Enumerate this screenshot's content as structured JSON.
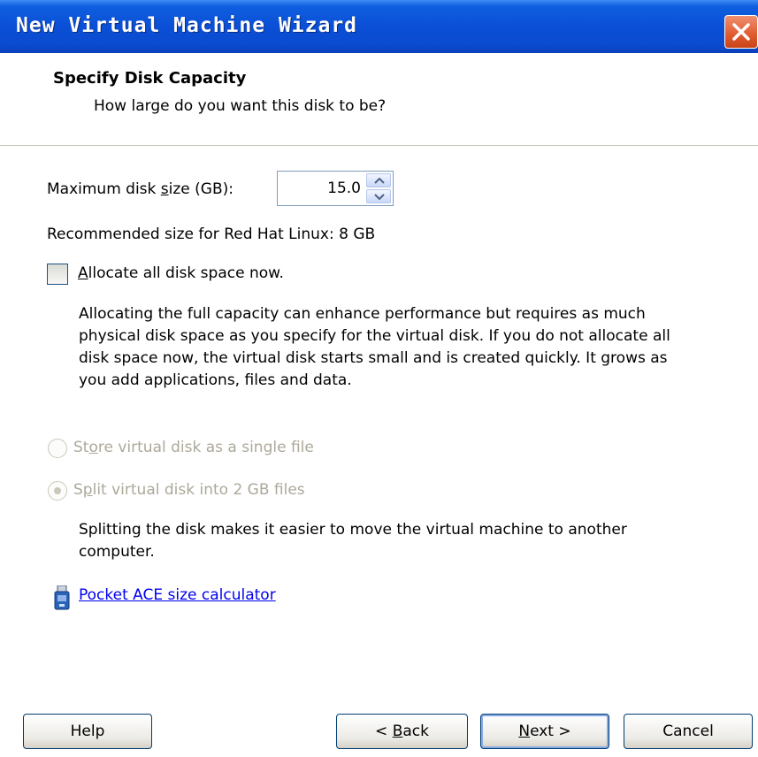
{
  "window": {
    "title": "New Virtual Machine Wizard"
  },
  "header": {
    "title": "Specify Disk Capacity",
    "subtitle": "How large do you want this disk to be?"
  },
  "disk_size": {
    "label_prefix": "Maximum disk ",
    "label_mnemonic": "s",
    "label_suffix": "ize (GB):",
    "value": "15.0"
  },
  "recommended": "Recommended size for Red Hat Linux: 8 GB",
  "allocate": {
    "mnemonic": "A",
    "label_rest": "llocate all disk space now.",
    "checked": false,
    "description_lines": [
      "Allocating the full capacity can enhance performance but requires as much",
      "physical disk space as you specify for the virtual disk. If you do not allocate all",
      "disk space now, the virtual disk starts small and is created quickly. It grows as",
      "you add applications, files and data."
    ]
  },
  "store_single": {
    "label_prefix": "St",
    "mnemonic": "o",
    "label_suffix": "re virtual disk as a single file",
    "selected": false,
    "enabled": false
  },
  "split_files": {
    "label_prefix": "S",
    "mnemonic": "p",
    "label_suffix": "lit virtual disk into 2 GB files",
    "selected": true,
    "enabled": false,
    "description_lines": [
      "Splitting the disk makes it easier to move the virtual machine to another",
      "computer."
    ]
  },
  "link": {
    "label": "Pocket ACE size calculator",
    "icon": "usb-device-icon"
  },
  "buttons": {
    "help": "Help",
    "back_prefix": "< ",
    "back_mnemonic": "B",
    "back_suffix": "ack",
    "next_mnemonic": "N",
    "next_suffix": "ext >",
    "cancel": "Cancel"
  },
  "colors": {
    "title_bar": "#0b4bd0",
    "close_button": "#e05a2e",
    "link": "#0000ee",
    "disabled_text": "#aca899"
  }
}
